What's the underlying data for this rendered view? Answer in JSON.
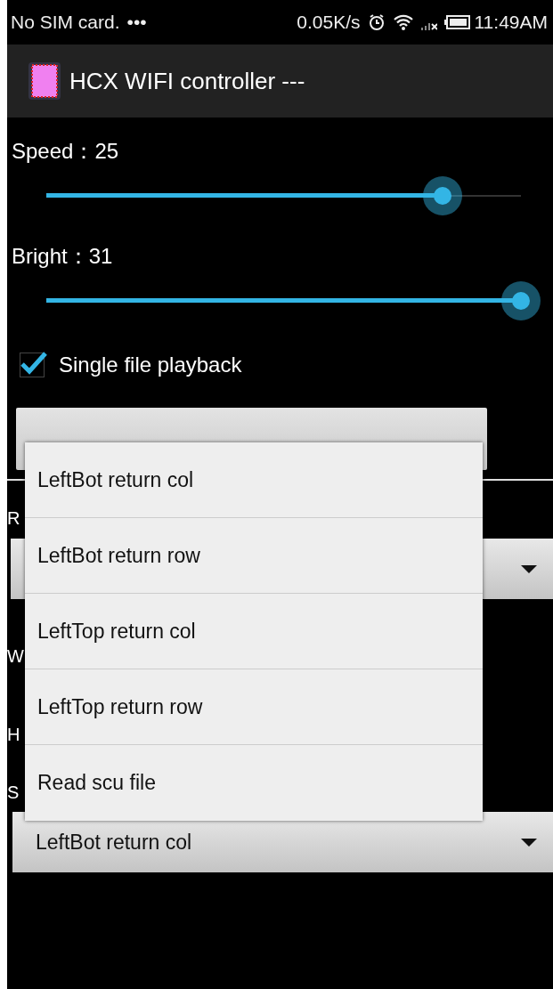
{
  "status_bar": {
    "carrier": "No SIM card.",
    "more": "•••",
    "speed": "0.05K/s",
    "time": "11:49AM"
  },
  "action_bar": {
    "title": "HCX WIFI controller ---"
  },
  "sliders": [
    {
      "label": "Speed：25",
      "level": 0.835
    },
    {
      "label": "Bright：31",
      "level": 1.0
    }
  ],
  "checkbox": {
    "label": "Single file playback",
    "checked": true
  },
  "labels": [
    "R",
    "W",
    "H",
    "S"
  ],
  "spinner": {
    "value": "LeftBot return col"
  },
  "popup_menu": {
    "items": [
      {
        "label": "LeftBot return col"
      },
      {
        "label": "LeftBot return row"
      },
      {
        "label": "LeftTop return col"
      },
      {
        "label": "LeftTop return row"
      },
      {
        "label": "Read scu file"
      }
    ]
  }
}
